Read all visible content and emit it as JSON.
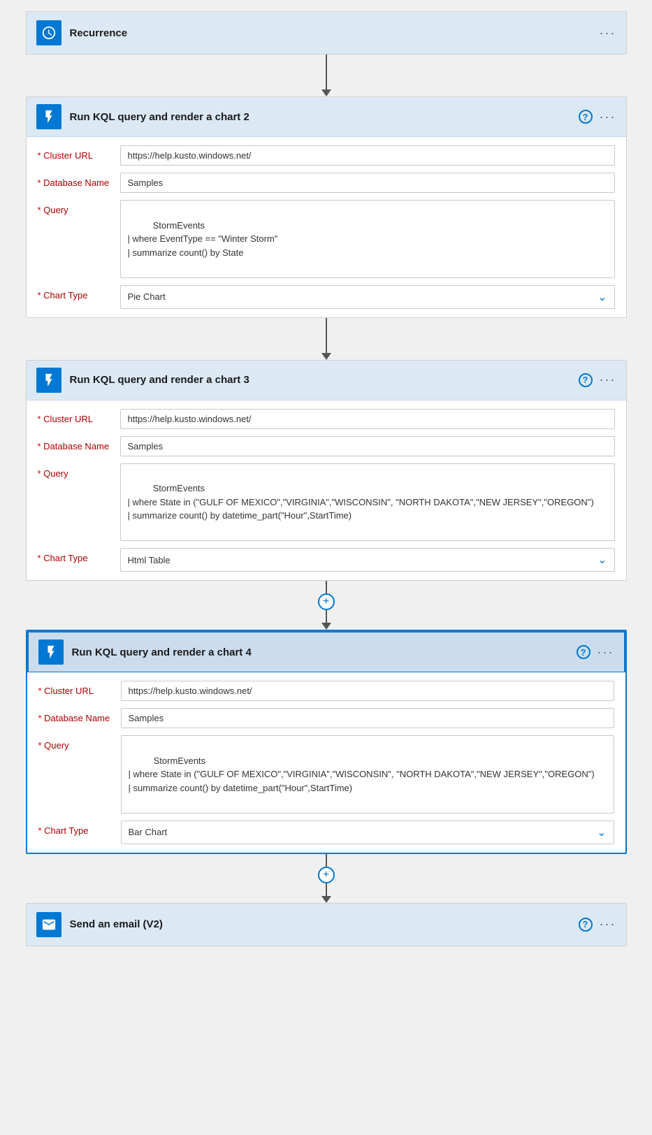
{
  "recurrence": {
    "title": "Recurrence",
    "more_label": "···"
  },
  "card2": {
    "title": "Run KQL query and render a chart 2",
    "help_label": "?",
    "more_label": "···",
    "fields": {
      "cluster_url_label": "Cluster URL",
      "cluster_url_value": "https://help.kusto.windows.net/",
      "database_name_label": "Database Name",
      "database_name_value": "Samples",
      "query_label": "Query",
      "query_value": "StormEvents\n| where EventType == \"Winter Storm\"\n| summarize count() by State",
      "chart_type_label": "Chart Type",
      "chart_type_value": "Pie Chart"
    }
  },
  "card3": {
    "title": "Run KQL query and render a chart 3",
    "help_label": "?",
    "more_label": "···",
    "fields": {
      "cluster_url_label": "Cluster URL",
      "cluster_url_value": "https://help.kusto.windows.net/",
      "database_name_label": "Database Name",
      "database_name_value": "Samples",
      "query_label": "Query",
      "query_value": "StormEvents\n| where State in (\"GULF OF MEXICO\",\"VIRGINIA\",\"WISCONSIN\", \"NORTH DAKOTA\",\"NEW JERSEY\",\"OREGON\")\n| summarize count() by datetime_part(\"Hour\",StartTime)",
      "chart_type_label": "Chart Type",
      "chart_type_value": "Html Table"
    }
  },
  "card4": {
    "title": "Run KQL query and render a chart 4",
    "help_label": "?",
    "more_label": "···",
    "fields": {
      "cluster_url_label": "Cluster URL",
      "cluster_url_value": "https://help.kusto.windows.net/",
      "database_name_label": "Database Name",
      "database_name_value": "Samples",
      "query_label": "Query",
      "query_value": "StormEvents\n| where State in (\"GULF OF MEXICO\",\"VIRGINIA\",\"WISCONSIN\", \"NORTH DAKOTA\",\"NEW JERSEY\",\"OREGON\")\n| summarize count() by datetime_part(\"Hour\",StartTime)",
      "chart_type_label": "Chart Type",
      "chart_type_value": "Bar Chart"
    }
  },
  "send_email": {
    "title": "Send an email (V2)",
    "help_label": "?",
    "more_label": "···"
  },
  "icons": {
    "recurrence": "clock",
    "kql": "lightning",
    "email": "email",
    "help": "?",
    "more": "···",
    "chevron_down": "⌄",
    "plus": "+"
  }
}
